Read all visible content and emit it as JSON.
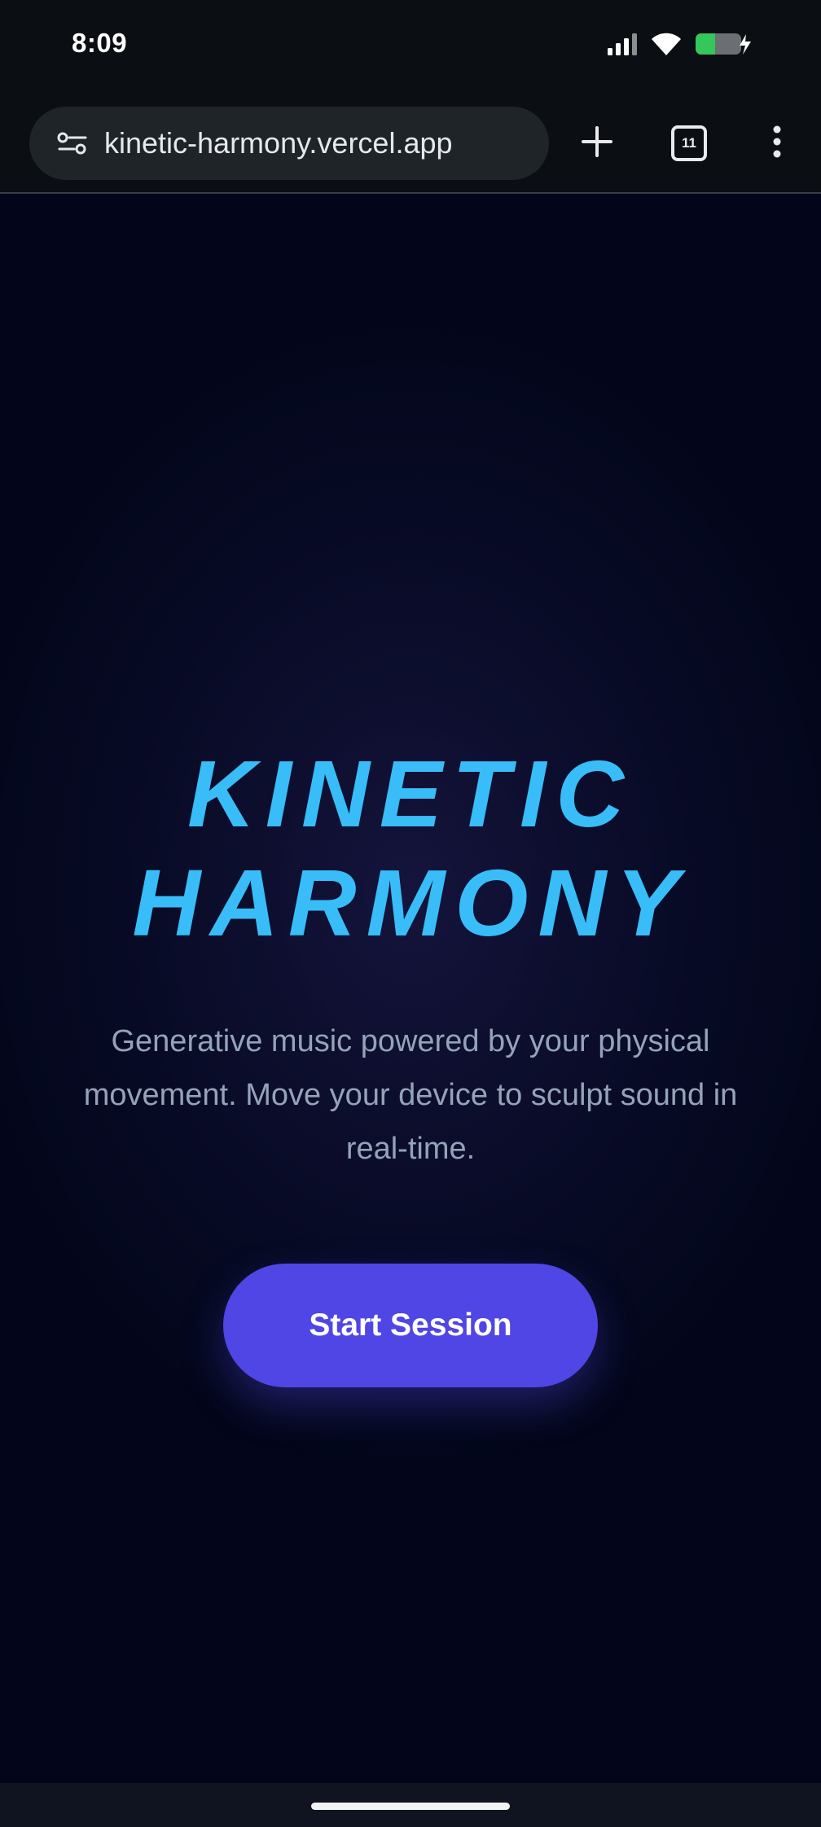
{
  "status_bar": {
    "time": "8:09",
    "icons": [
      "signal-icon",
      "wifi-icon",
      "battery-charging-icon"
    ],
    "battery_color": "#34c759"
  },
  "browser": {
    "url": "kinetic-harmony.vercel.app",
    "tab_count": "11",
    "icons": [
      "site-settings-icon",
      "new-tab-plus-icon",
      "tab-switcher-icon",
      "more-menu-icon"
    ]
  },
  "hero": {
    "title_line1": "KINETIC",
    "title_line2": "HARMONY",
    "subtitle": "Generative music powered by your physical movement. Move your device to sculpt sound in real-time.",
    "cta_label": "Start Session"
  },
  "colors": {
    "title": "#38bdf8",
    "subtitle": "#94a3b8",
    "cta_background": "#4f46e5",
    "page_background": "#03061a"
  }
}
